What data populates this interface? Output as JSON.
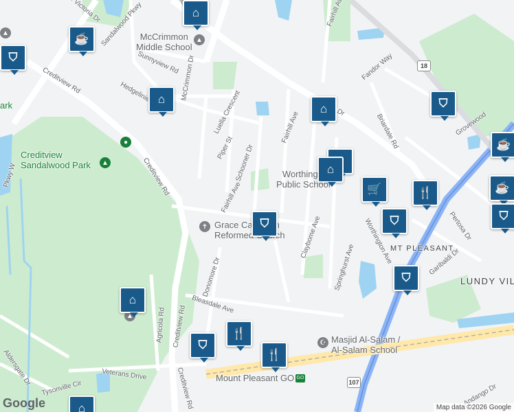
{
  "streets": {
    "victoria": "n Victoria Dr",
    "sandalwood_pkwy": "Sandalwood Pkwy",
    "sandalwood_pkwy_b": "Sandalwood",
    "sunnyview": "Sunnyview Rd",
    "mccrimmon": "McCrimmon Dr",
    "hedgelinie": "Hedgelinie Dr",
    "creditview_nw": "Creditview Rd",
    "creditview_mid": "Creditview Rd",
    "creditview_s": "Creditview Rd",
    "creditview_se": "Creditview Rd",
    "luella": "Luella Crescent",
    "piper": "Piper St",
    "schooner": "Schooner Dr",
    "fairhill_s": "Fairhill Ave",
    "fairhill_m": "Fairhill Ave",
    "fairhill_n": "Fairhill Ave",
    "fandor": "Fandor Way",
    "bovaird": "Bovaird Dr",
    "briardale": "Briardale Rd",
    "grovewood": "Grovewood",
    "claybome": "Claybome Ave",
    "springhurst": "Springhurst Ave",
    "worthington": "Worthington Ave",
    "pertosa": "Pertosa Dr",
    "garibaldi": "Garibaldi Dr",
    "donomore": "Donomore Dr",
    "bleasdale": "Bleasdale Ave",
    "agricola": "Agricola Rd",
    "veterans": "Veterans Drive",
    "tysonville": "Tysonville Cir",
    "aldersgate": "Aldersgate Dr",
    "pkwy_w": "Pkwy W",
    "andango": "Andango Dr"
  },
  "pois": {
    "mccrimmon_school": "McCrimmon\nMiddle School",
    "creditview_park": "Creditview\nSandalwood Park",
    "park_cut": "ark",
    "grace_church": "Grace Canadian\nReformed Church",
    "worthington_school": "Worthington\nPublic School",
    "masjid": "Masjid Al-Salam /\nAl-Salam School",
    "mount_pleasant_go": "Mount Pleasant GO",
    "mt_pleasant": "MT PLEASANT",
    "lundy": "LUNDY VILL"
  },
  "route_shields": {
    "r18": "18",
    "r107": "107"
  },
  "attribution": "Map data ©2026 Google",
  "logo": "Google",
  "pins": [
    {
      "type": "school",
      "icon": "school-icon"
    },
    {
      "type": "cafe",
      "icon": "coffee-icon"
    },
    {
      "type": "shop",
      "icon": "shopping-bag-icon"
    },
    {
      "type": "school",
      "icon": "school-icon"
    },
    {
      "type": "school",
      "icon": "school-icon"
    },
    {
      "type": "school",
      "icon": "school-icon"
    },
    {
      "type": "shop",
      "icon": "shopping-bag-icon"
    },
    {
      "type": "school",
      "icon": "school-icon"
    },
    {
      "type": "grocery",
      "icon": "shopping-cart-icon"
    },
    {
      "type": "shop",
      "icon": "shopping-bag-icon"
    },
    {
      "type": "restaurant",
      "icon": "restaurant-icon"
    },
    {
      "type": "cafe",
      "icon": "coffee-icon"
    },
    {
      "type": "cafe",
      "icon": "coffee-icon"
    },
    {
      "type": "shop",
      "icon": "shopping-bag-icon"
    },
    {
      "type": "school",
      "icon": "school-icon"
    },
    {
      "type": "shop",
      "icon": "shopping-bag-icon"
    },
    {
      "type": "restaurant",
      "icon": "restaurant-icon"
    },
    {
      "type": "restaurant",
      "icon": "restaurant-icon"
    },
    {
      "type": "shop",
      "icon": "shopping-bag-icon"
    }
  ]
}
